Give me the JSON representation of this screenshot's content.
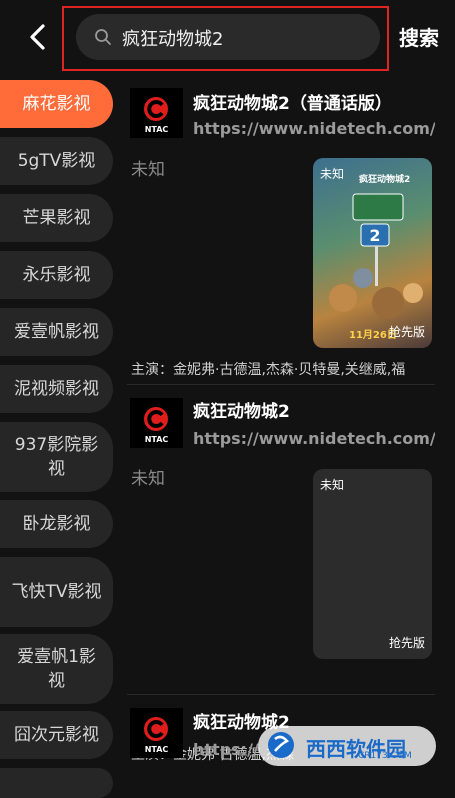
{
  "header": {
    "search_query": "疯狂动物城2",
    "search_button": "搜索"
  },
  "sidebar": {
    "items": [
      {
        "label": "麻花影视",
        "active": true
      },
      {
        "label": "5gTV影视"
      },
      {
        "label": "芒果影视"
      },
      {
        "label": "永乐影视"
      },
      {
        "label": "爱壹帆影视"
      },
      {
        "label": "泥视频影视"
      },
      {
        "label": "937影院影视"
      },
      {
        "label": "卧龙影视"
      },
      {
        "label": "飞快TV影视"
      },
      {
        "label": "爱壹帆1影视"
      },
      {
        "label": "囧次元影视"
      }
    ]
  },
  "results": [
    {
      "logo_text": "NTAC",
      "title": "疯狂动物城2（普通话版）",
      "url": "https://www.nidetech.com/",
      "year": "未知",
      "poster_tag": "未知",
      "poster_badge": "抢先版",
      "poster_caption": "疯狂动物城2",
      "poster_date": "11月26日",
      "cast": "主演：金妮弗·古德温,杰森·贝特曼,关继威,福"
    },
    {
      "logo_text": "NTAC",
      "title": "疯狂动物城2",
      "url": "https://www.nidetech.com/",
      "year": "未知",
      "poster_tag": "未知",
      "poster_badge": "抢先版",
      "cast": "主演：金妮弗·古德温,杰森"
    },
    {
      "logo_text": "NTAC",
      "title": "疯狂动物城2",
      "url": "https://"
    }
  ],
  "watermark": {
    "text": "西西软件园",
    "sub": "CR173.COM"
  },
  "colors": {
    "accent": "#ff6b39",
    "highlight_border": "#e02424",
    "background": "#121212"
  }
}
